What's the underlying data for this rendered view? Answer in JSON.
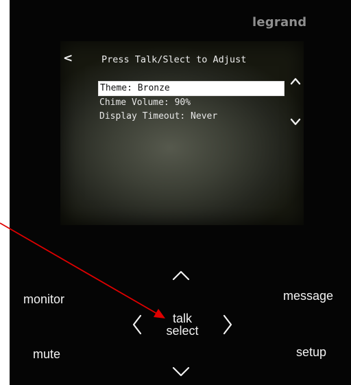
{
  "brand": "legrand",
  "screen": {
    "back_symbol": "<",
    "title": "Press Talk/Slect to Adjust",
    "items": [
      {
        "label": "Theme: Bronze",
        "selected": true
      },
      {
        "label": "Chime Volume: 90%",
        "selected": false
      },
      {
        "label": "Display Timeout: Never",
        "selected": false
      }
    ],
    "scroll_up_icon": "chevron-up-icon",
    "scroll_down_icon": "chevron-down-icon"
  },
  "buttons": {
    "monitor": "monitor",
    "message": "message",
    "mute": "mute",
    "setup": "setup",
    "talk": "talk",
    "select": "select"
  },
  "nav_icons": {
    "up": "chevron-up-icon",
    "down": "chevron-down-icon",
    "left": "chevron-left-icon",
    "right": "chevron-right-icon"
  },
  "colors": {
    "panel": "#050505",
    "annotation_arrow": "#e00000",
    "selection_highlight": "#ffffff",
    "brand_text": "#8f8f8f"
  }
}
